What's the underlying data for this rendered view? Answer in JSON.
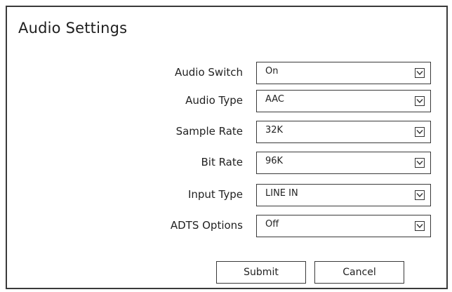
{
  "panel": {
    "title": "Audio Settings"
  },
  "fields": [
    {
      "label": "Audio Switch",
      "value": "On",
      "icon": "chevron-down-icon"
    },
    {
      "label": "Audio Type",
      "value": "AAC",
      "icon": "chevron-down-icon"
    },
    {
      "label": "Sample Rate",
      "value": "32K",
      "icon": "chevron-down-icon"
    },
    {
      "label": "Bit Rate",
      "value": "96K",
      "icon": "chevron-down-icon"
    },
    {
      "label": "Input Type",
      "value": "LINE IN",
      "icon": "chevron-down-icon"
    },
    {
      "label": "ADTS Options",
      "value": "Off",
      "icon": "chevron-down-icon"
    }
  ],
  "buttons": {
    "submit_label": "Submit",
    "cancel_label": "Cancel"
  },
  "colors": {
    "border": "#3a3a3a",
    "text": "#222222",
    "background": "#ffffff"
  }
}
